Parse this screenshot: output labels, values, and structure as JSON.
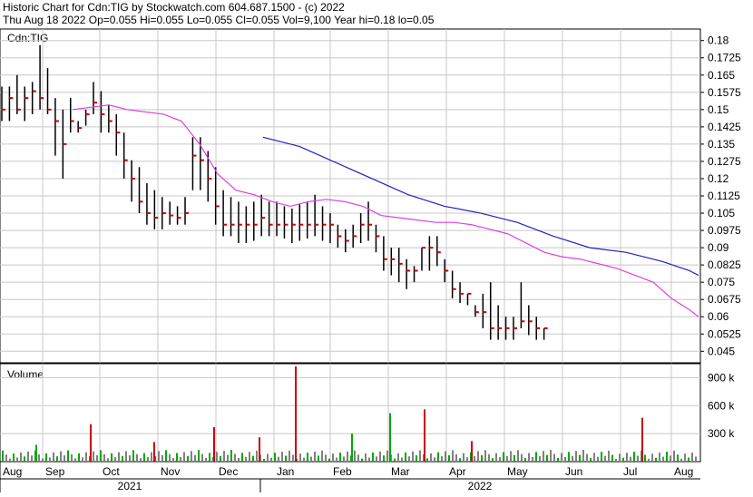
{
  "header": {
    "title": "Historic Chart for Cdn:TIG by Stockwatch.com 604.687.1500 - (c) 2022",
    "quote": "Thu Aug 18 2022   Op=0.055   Hi=0.055   Lo=0.055   Cl=0.055   Vol=9,100   Year hi=0.18   lo=0.05"
  },
  "chart_data": [
    {
      "type": "ohlc",
      "label": "Cdn:TIG",
      "ylim": [
        0.04,
        0.185
      ],
      "y_ticks": [
        "0.18",
        "0.1725",
        "0.165",
        "0.1575",
        "0.15",
        "0.1425",
        "0.135",
        "0.1275",
        "0.12",
        "0.1125",
        "0.105",
        "0.0975",
        "0.09",
        "0.0825",
        "0.075",
        "0.0675",
        "0.06",
        "0.0525",
        "0.045"
      ],
      "y_tick_values": [
        0.18,
        0.1725,
        0.165,
        0.1575,
        0.15,
        0.1425,
        0.135,
        0.1275,
        0.12,
        0.1125,
        0.105,
        0.0975,
        0.09,
        0.0825,
        0.075,
        0.0675,
        0.06,
        0.0525,
        0.045
      ],
      "x_months": [
        "Aug",
        "Sep",
        "Oct",
        "Nov",
        "Dec",
        "Jan",
        "Feb",
        "Mar",
        "Apr",
        "May",
        "Jun",
        "Jul",
        "Aug"
      ],
      "years": [
        "2021",
        "2022"
      ],
      "grid": true,
      "series": [
        {
          "name": "",
          "color": "#000000",
          "kind": "bars",
          "x": [
            0,
            4,
            8,
            12,
            16,
            20,
            24,
            28,
            32,
            36,
            40,
            44,
            48,
            52,
            56,
            60,
            64,
            68,
            72,
            76,
            80,
            84,
            88,
            92,
            96,
            100,
            104,
            108,
            112,
            116,
            120,
            124,
            128,
            132,
            136,
            140,
            144,
            148,
            152,
            156,
            160,
            164,
            168,
            172,
            176,
            180,
            184,
            188,
            192,
            196,
            200,
            204,
            208,
            212,
            216,
            220,
            224,
            228,
            232,
            236,
            240,
            244,
            248,
            252,
            256,
            260,
            264,
            268,
            272,
            276,
            280,
            284,
            288,
            292,
            296,
            300,
            304,
            308,
            312,
            316,
            320,
            324,
            328,
            332,
            336,
            340,
            344,
            348,
            352,
            356,
            360,
            364
          ],
          "high": [
            0.16,
            0.16,
            0.165,
            0.16,
            0.162,
            0.178,
            0.168,
            0.155,
            0.15,
            0.155,
            0.145,
            0.15,
            0.162,
            0.158,
            0.152,
            0.148,
            0.14,
            0.128,
            0.125,
            0.118,
            0.115,
            0.112,
            0.11,
            0.108,
            0.112,
            0.138,
            0.138,
            0.132,
            0.125,
            0.115,
            0.112,
            0.11,
            0.108,
            0.11,
            0.113,
            0.11,
            0.11,
            0.108,
            0.107,
            0.109,
            0.11,
            0.113,
            0.108,
            0.105,
            0.1,
            0.098,
            0.1,
            0.105,
            0.11,
            0.1,
            0.095,
            0.09,
            0.09,
            0.085,
            0.082,
            0.09,
            0.095,
            0.095,
            0.085,
            0.08,
            0.075,
            0.07,
            0.065,
            0.07,
            0.075,
            0.065,
            0.06,
            0.06,
            0.075,
            0.065,
            0.06,
            0.055
          ],
          "low": [
            0.145,
            0.145,
            0.148,
            0.145,
            0.148,
            0.15,
            0.148,
            0.13,
            0.12,
            0.14,
            0.14,
            0.143,
            0.148,
            0.14,
            0.14,
            0.13,
            0.12,
            0.11,
            0.105,
            0.1,
            0.098,
            0.098,
            0.1,
            0.1,
            0.1,
            0.115,
            0.115,
            0.11,
            0.1,
            0.095,
            0.095,
            0.092,
            0.092,
            0.093,
            0.095,
            0.095,
            0.095,
            0.094,
            0.092,
            0.093,
            0.094,
            0.095,
            0.093,
            0.092,
            0.09,
            0.088,
            0.09,
            0.092,
            0.093,
            0.088,
            0.08,
            0.078,
            0.075,
            0.072,
            0.075,
            0.08,
            0.08,
            0.082,
            0.075,
            0.068,
            0.066,
            0.065,
            0.06,
            0.055,
            0.05,
            0.05,
            0.05,
            0.05,
            0.055,
            0.052,
            0.05,
            0.05
          ],
          "close": [
            0.15,
            0.155,
            0.15,
            0.155,
            0.158,
            0.155,
            0.15,
            0.145,
            0.135,
            0.145,
            0.142,
            0.148,
            0.153,
            0.148,
            0.145,
            0.14,
            0.128,
            0.12,
            0.11,
            0.105,
            0.103,
            0.105,
            0.104,
            0.103,
            0.105,
            0.13,
            0.128,
            0.12,
            0.108,
            0.1,
            0.1,
            0.1,
            0.1,
            0.1,
            0.103,
            0.1,
            0.1,
            0.1,
            0.1,
            0.1,
            0.1,
            0.1,
            0.1,
            0.1,
            0.095,
            0.093,
            0.095,
            0.1,
            0.1,
            0.095,
            0.085,
            0.085,
            0.083,
            0.08,
            0.08,
            0.09,
            0.09,
            0.088,
            0.08,
            0.072,
            0.07,
            0.07,
            0.062,
            0.062,
            0.055,
            0.055,
            0.055,
            0.055,
            0.058,
            0.058,
            0.055,
            0.055
          ]
        },
        {
          "name": "",
          "color": "#e040e0",
          "kind": "ma",
          "x": [
            80,
            100,
            120,
            140,
            160,
            180,
            200,
            220,
            240,
            260,
            280,
            300,
            320,
            340,
            360,
            380,
            400,
            420,
            440,
            460,
            480,
            500,
            520,
            540,
            560,
            580,
            600,
            620,
            640,
            660,
            680,
            700,
            720,
            740,
            760,
            770
          ],
          "values": [
            0.15,
            0.151,
            0.152,
            0.15,
            0.149,
            0.148,
            0.145,
            0.135,
            0.122,
            0.115,
            0.113,
            0.11,
            0.108,
            0.11,
            0.111,
            0.11,
            0.108,
            0.104,
            0.103,
            0.102,
            0.101,
            0.101,
            0.1,
            0.098,
            0.096,
            0.092,
            0.088,
            0.086,
            0.085,
            0.083,
            0.081,
            0.078,
            0.075,
            0.068,
            0.063,
            0.06
          ]
        },
        {
          "name": "",
          "color": "#2020c0",
          "kind": "ma",
          "x": [
            290,
            330,
            370,
            410,
            450,
            490,
            530,
            570,
            610,
            650,
            690,
            730,
            760,
            770
          ],
          "values": [
            0.138,
            0.134,
            0.127,
            0.12,
            0.113,
            0.108,
            0.105,
            0.101,
            0.095,
            0.09,
            0.088,
            0.084,
            0.08,
            0.078
          ]
        }
      ]
    },
    {
      "type": "bar",
      "label": "Volume",
      "ylim": [
        0,
        1050000
      ],
      "y_ticks": [
        "900 k",
        "600 k",
        "300 k"
      ],
      "y_tick_values": [
        900000,
        600000,
        300000
      ],
      "grid": true,
      "spikes": [
        {
          "x": 326,
          "value": 1020000,
          "color": "#cc0000"
        },
        {
          "x": 468,
          "value": 560000,
          "color": "#cc0000"
        },
        {
          "x": 430,
          "value": 520000,
          "color": "#00aa00"
        },
        {
          "x": 708,
          "value": 470000,
          "color": "#cc0000"
        },
        {
          "x": 100,
          "value": 400000,
          "color": "#cc0000"
        },
        {
          "x": 236,
          "value": 370000,
          "color": "#cc0000"
        },
        {
          "x": 388,
          "value": 300000,
          "color": "#00aa00"
        },
        {
          "x": 286,
          "value": 260000,
          "color": "#cc0000"
        },
        {
          "x": 520,
          "value": 220000,
          "color": "#cc0000"
        },
        {
          "x": 170,
          "value": 210000,
          "color": "#cc0000"
        },
        {
          "x": 40,
          "value": 180000,
          "color": "#00aa00"
        }
      ]
    }
  ]
}
